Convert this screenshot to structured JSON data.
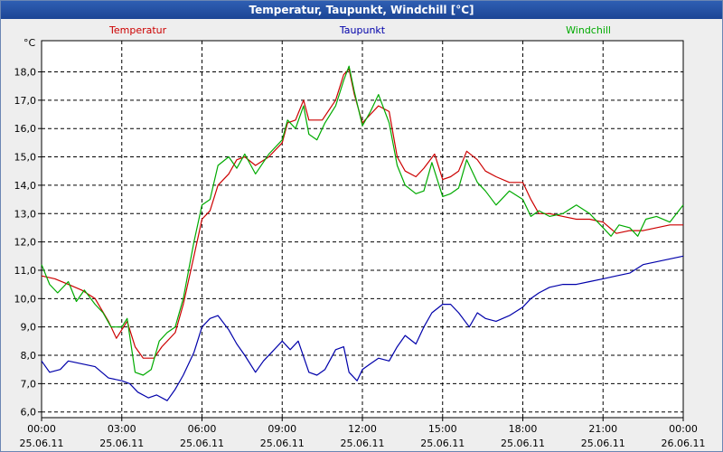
{
  "window": {
    "title": "Temperatur, Taupunkt, Windchill [°C]"
  },
  "colors": {
    "plot_bg": "#ffffff",
    "grid": "#000000",
    "temperatur": "#cc0000",
    "taupunkt": "#0000aa",
    "windchill": "#00aa00"
  },
  "chart_data": {
    "type": "line",
    "title": "Temperatur, Taupunkt, Windchill [°C]",
    "ylabel": "°C",
    "ylim": [
      5.8,
      19.1
    ],
    "yticks": [
      6.0,
      7.0,
      8.0,
      9.0,
      10.0,
      11.0,
      12.0,
      13.0,
      14.0,
      15.0,
      16.0,
      17.0,
      18.0
    ],
    "ytick_labels": [
      "6,0",
      "7,0",
      "8,0",
      "9,0",
      "10,0",
      "11,0",
      "12,0",
      "13,0",
      "14,0",
      "15,0",
      "16,0",
      "17,0",
      "18,0"
    ],
    "xlim": [
      0,
      24
    ],
    "xticks": [
      {
        "time": "00:00",
        "date": "25.06.11"
      },
      {
        "time": "03:00",
        "date": "25.06.11"
      },
      {
        "time": "06:00",
        "date": "25.06.11"
      },
      {
        "time": "09:00",
        "date": "25.06.11"
      },
      {
        "time": "12:00",
        "date": "25.06.11"
      },
      {
        "time": "15:00",
        "date": "25.06.11"
      },
      {
        "time": "18:00",
        "date": "25.06.11"
      },
      {
        "time": "21:00",
        "date": "25.06.11"
      },
      {
        "time": "00:00",
        "date": "26.06.11"
      }
    ],
    "grid": true,
    "legend_position": "top",
    "series": [
      {
        "name": "Temperatur",
        "color": "#cc0000",
        "points": [
          [
            0,
            10.8
          ],
          [
            0.5,
            10.7
          ],
          [
            1,
            10.5
          ],
          [
            1.5,
            10.3
          ],
          [
            2,
            10.0
          ],
          [
            2.5,
            9.2
          ],
          [
            2.8,
            8.6
          ],
          [
            3.2,
            9.2
          ],
          [
            3.5,
            8.3
          ],
          [
            3.8,
            7.9
          ],
          [
            4.2,
            7.9
          ],
          [
            4.5,
            8.3
          ],
          [
            5,
            8.8
          ],
          [
            5.3,
            9.8
          ],
          [
            5.7,
            11.5
          ],
          [
            6,
            12.8
          ],
          [
            6.3,
            13.1
          ],
          [
            6.6,
            14.0
          ],
          [
            7,
            14.4
          ],
          [
            7.3,
            14.9
          ],
          [
            7.6,
            15.0
          ],
          [
            8,
            14.7
          ],
          [
            8.5,
            15.0
          ],
          [
            9,
            15.5
          ],
          [
            9.2,
            16.2
          ],
          [
            9.5,
            16.3
          ],
          [
            9.8,
            17.0
          ],
          [
            10,
            16.3
          ],
          [
            10.5,
            16.3
          ],
          [
            11,
            17.0
          ],
          [
            11.3,
            17.9
          ],
          [
            11.5,
            18.1
          ],
          [
            11.7,
            17.2
          ],
          [
            12,
            16.2
          ],
          [
            12.3,
            16.5
          ],
          [
            12.6,
            16.8
          ],
          [
            13,
            16.6
          ],
          [
            13.3,
            15.0
          ],
          [
            13.6,
            14.5
          ],
          [
            14,
            14.3
          ],
          [
            14.3,
            14.6
          ],
          [
            14.7,
            15.1
          ],
          [
            15,
            14.2
          ],
          [
            15.3,
            14.3
          ],
          [
            15.6,
            14.5
          ],
          [
            15.9,
            15.2
          ],
          [
            16.3,
            14.9
          ],
          [
            16.6,
            14.5
          ],
          [
            17,
            14.3
          ],
          [
            17.5,
            14.1
          ],
          [
            18,
            14.1
          ],
          [
            18.3,
            13.5
          ],
          [
            18.6,
            13.0
          ],
          [
            19,
            13.0
          ],
          [
            19.5,
            12.9
          ],
          [
            20,
            12.8
          ],
          [
            20.5,
            12.8
          ],
          [
            21,
            12.7
          ],
          [
            21.5,
            12.3
          ],
          [
            22,
            12.4
          ],
          [
            22.5,
            12.4
          ],
          [
            23,
            12.5
          ],
          [
            23.5,
            12.6
          ],
          [
            24,
            12.6
          ]
        ]
      },
      {
        "name": "Taupunkt",
        "color": "#0000aa",
        "points": [
          [
            0,
            7.8
          ],
          [
            0.3,
            7.4
          ],
          [
            0.7,
            7.5
          ],
          [
            1,
            7.8
          ],
          [
            1.5,
            7.7
          ],
          [
            2,
            7.6
          ],
          [
            2.5,
            7.2
          ],
          [
            3,
            7.1
          ],
          [
            3.3,
            7.0
          ],
          [
            3.6,
            6.7
          ],
          [
            4,
            6.5
          ],
          [
            4.3,
            6.6
          ],
          [
            4.7,
            6.4
          ],
          [
            5,
            6.8
          ],
          [
            5.3,
            7.3
          ],
          [
            5.7,
            8.1
          ],
          [
            6,
            9.0
          ],
          [
            6.3,
            9.3
          ],
          [
            6.6,
            9.4
          ],
          [
            7,
            8.9
          ],
          [
            7.3,
            8.4
          ],
          [
            7.6,
            8.0
          ],
          [
            8,
            7.4
          ],
          [
            8.3,
            7.8
          ],
          [
            8.6,
            8.1
          ],
          [
            9,
            8.5
          ],
          [
            9.3,
            8.2
          ],
          [
            9.6,
            8.5
          ],
          [
            10,
            7.4
          ],
          [
            10.3,
            7.3
          ],
          [
            10.6,
            7.5
          ],
          [
            11,
            8.2
          ],
          [
            11.3,
            8.3
          ],
          [
            11.5,
            7.4
          ],
          [
            11.8,
            7.1
          ],
          [
            12,
            7.5
          ],
          [
            12.3,
            7.7
          ],
          [
            12.6,
            7.9
          ],
          [
            13,
            7.8
          ],
          [
            13.3,
            8.3
          ],
          [
            13.6,
            8.7
          ],
          [
            14,
            8.4
          ],
          [
            14.3,
            9.0
          ],
          [
            14.6,
            9.5
          ],
          [
            15,
            9.8
          ],
          [
            15.3,
            9.8
          ],
          [
            15.6,
            9.5
          ],
          [
            16,
            9.0
          ],
          [
            16.3,
            9.5
          ],
          [
            16.6,
            9.3
          ],
          [
            17,
            9.2
          ],
          [
            17.5,
            9.4
          ],
          [
            18,
            9.7
          ],
          [
            18.3,
            10.0
          ],
          [
            18.6,
            10.2
          ],
          [
            19,
            10.4
          ],
          [
            19.5,
            10.5
          ],
          [
            20,
            10.5
          ],
          [
            20.5,
            10.6
          ],
          [
            21,
            10.7
          ],
          [
            21.5,
            10.8
          ],
          [
            22,
            10.9
          ],
          [
            22.5,
            11.2
          ],
          [
            23,
            11.3
          ],
          [
            23.5,
            11.4
          ],
          [
            24,
            11.5
          ]
        ]
      },
      {
        "name": "Windchill",
        "color": "#00aa00",
        "points": [
          [
            0,
            11.2
          ],
          [
            0.3,
            10.5
          ],
          [
            0.6,
            10.2
          ],
          [
            1,
            10.6
          ],
          [
            1.3,
            9.9
          ],
          [
            1.6,
            10.3
          ],
          [
            2,
            9.8
          ],
          [
            2.3,
            9.5
          ],
          [
            2.6,
            9.0
          ],
          [
            3,
            9.0
          ],
          [
            3.2,
            9.3
          ],
          [
            3.5,
            7.4
          ],
          [
            3.8,
            7.3
          ],
          [
            4.1,
            7.5
          ],
          [
            4.4,
            8.5
          ],
          [
            4.7,
            8.8
          ],
          [
            5,
            9.0
          ],
          [
            5.3,
            10.0
          ],
          [
            5.7,
            12.0
          ],
          [
            6,
            13.3
          ],
          [
            6.3,
            13.5
          ],
          [
            6.6,
            14.7
          ],
          [
            7,
            15.0
          ],
          [
            7.3,
            14.6
          ],
          [
            7.6,
            15.1
          ],
          [
            8,
            14.4
          ],
          [
            8.5,
            15.1
          ],
          [
            9,
            15.6
          ],
          [
            9.2,
            16.3
          ],
          [
            9.5,
            16.0
          ],
          [
            9.8,
            16.8
          ],
          [
            10,
            15.8
          ],
          [
            10.3,
            15.6
          ],
          [
            10.6,
            16.2
          ],
          [
            11,
            16.8
          ],
          [
            11.3,
            17.7
          ],
          [
            11.5,
            18.2
          ],
          [
            11.7,
            17.3
          ],
          [
            12,
            16.1
          ],
          [
            12.3,
            16.6
          ],
          [
            12.6,
            17.2
          ],
          [
            13,
            16.2
          ],
          [
            13.3,
            14.7
          ],
          [
            13.6,
            14.0
          ],
          [
            14,
            13.7
          ],
          [
            14.3,
            13.8
          ],
          [
            14.6,
            14.8
          ],
          [
            15,
            13.6
          ],
          [
            15.3,
            13.7
          ],
          [
            15.6,
            13.9
          ],
          [
            15.9,
            14.9
          ],
          [
            16.3,
            14.1
          ],
          [
            16.6,
            13.8
          ],
          [
            17,
            13.3
          ],
          [
            17.5,
            13.8
          ],
          [
            18,
            13.5
          ],
          [
            18.3,
            12.9
          ],
          [
            18.6,
            13.1
          ],
          [
            19,
            12.9
          ],
          [
            19.5,
            13.0
          ],
          [
            20,
            13.3
          ],
          [
            20.5,
            13.0
          ],
          [
            21,
            12.5
          ],
          [
            21.3,
            12.2
          ],
          [
            21.6,
            12.6
          ],
          [
            22,
            12.5
          ],
          [
            22.3,
            12.2
          ],
          [
            22.6,
            12.8
          ],
          [
            23,
            12.9
          ],
          [
            23.5,
            12.7
          ],
          [
            24,
            13.3
          ]
        ]
      }
    ]
  }
}
